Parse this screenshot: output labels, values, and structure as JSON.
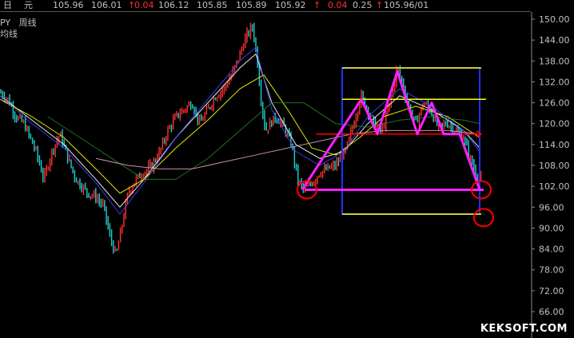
{
  "topbar": {
    "period": "日",
    "currency": "元",
    "fields": [
      "105.96",
      "106.01",
      "0.04",
      "106.12",
      "105.85",
      "105.89",
      "105.92",
      "0.04",
      "0.25",
      "105.96/01"
    ]
  },
  "legend": {
    "symbol_fragment": "PY",
    "period_label": "周线",
    "line2_fragment": "均线"
  },
  "watermark": "KEKSOFT.COM",
  "colors": {
    "up": "#ff3030",
    "down": "#20d0d0",
    "ma_white": "#ffffff",
    "ma_yellow": "#ffff00",
    "ma_blue": "#4040ff",
    "ma_green": "#208020",
    "ma_pink": "#e0a0c0",
    "pattern": "#ff20ff",
    "circle": "#ff0000",
    "channel_lines": "#ffff00",
    "box": "#2030ff",
    "neckline": "#ff0000"
  },
  "chart_data": {
    "type": "candlestick",
    "ylim": [
      63,
      152
    ],
    "yticks": [
      "150.00",
      "144.00",
      "138.00",
      "132.00",
      "126.00",
      "120.00",
      "114.00",
      "108.00",
      "102.00",
      "96.00",
      "90.00",
      "84.00",
      "78.00",
      "72.00",
      "66.00"
    ],
    "price_path": [
      [
        0,
        129
      ],
      [
        10,
        127
      ],
      [
        20,
        122
      ],
      [
        30,
        120
      ],
      [
        45,
        112
      ],
      [
        55,
        104
      ],
      [
        65,
        112
      ],
      [
        75,
        117
      ],
      [
        85,
        110
      ],
      [
        95,
        104
      ],
      [
        110,
        100
      ],
      [
        120,
        99
      ],
      [
        130,
        96
      ],
      [
        137,
        88
      ],
      [
        145,
        82
      ],
      [
        152,
        90
      ],
      [
        160,
        100
      ],
      [
        170,
        104
      ],
      [
        180,
        106
      ],
      [
        190,
        108
      ],
      [
        200,
        112
      ],
      [
        210,
        118
      ],
      [
        220,
        122
      ],
      [
        230,
        124
      ],
      [
        240,
        126
      ],
      [
        250,
        120
      ],
      [
        260,
        124
      ],
      [
        270,
        128
      ],
      [
        280,
        130
      ],
      [
        290,
        134
      ],
      [
        300,
        140
      ],
      [
        308,
        145
      ],
      [
        316,
        148
      ],
      [
        322,
        138
      ],
      [
        326,
        128
      ],
      [
        332,
        118
      ],
      [
        338,
        120
      ],
      [
        345,
        122
      ],
      [
        355,
        119
      ],
      [
        365,
        114
      ],
      [
        372,
        104
      ],
      [
        380,
        101
      ],
      [
        390,
        103
      ],
      [
        400,
        106
      ],
      [
        410,
        107
      ],
      [
        420,
        108
      ],
      [
        432,
        112
      ],
      [
        440,
        118
      ],
      [
        452,
        128
      ],
      [
        460,
        124
      ],
      [
        468,
        120
      ],
      [
        478,
        118
      ],
      [
        488,
        126
      ],
      [
        497,
        136
      ],
      [
        505,
        130
      ],
      [
        512,
        124
      ],
      [
        520,
        120
      ],
      [
        530,
        126
      ],
      [
        538,
        124
      ],
      [
        548,
        119
      ],
      [
        560,
        120
      ],
      [
        570,
        118
      ],
      [
        580,
        116
      ],
      [
        588,
        110
      ],
      [
        595,
        106
      ],
      [
        602,
        104
      ]
    ],
    "moving_averages": [
      {
        "name": "white",
        "points": [
          [
            0,
            128
          ],
          [
            40,
            121
          ],
          [
            80,
            114
          ],
          [
            120,
            104
          ],
          [
            150,
            96
          ],
          [
            180,
            104
          ],
          [
            220,
            116
          ],
          [
            260,
            126
          ],
          [
            300,
            136
          ],
          [
            320,
            140
          ],
          [
            340,
            126
          ],
          [
            370,
            114
          ],
          [
            400,
            110
          ],
          [
            430,
            112
          ],
          [
            460,
            120
          ],
          [
            500,
            128
          ],
          [
            540,
            124
          ],
          [
            580,
            118
          ],
          [
            600,
            113
          ]
        ]
      },
      {
        "name": "yellow",
        "points": [
          [
            0,
            127
          ],
          [
            40,
            122
          ],
          [
            80,
            116
          ],
          [
            120,
            107
          ],
          [
            150,
            100
          ],
          [
            180,
            104
          ],
          [
            220,
            113
          ],
          [
            260,
            121
          ],
          [
            300,
            130
          ],
          [
            330,
            134
          ],
          [
            360,
            124
          ],
          [
            390,
            113
          ],
          [
            420,
            111
          ],
          [
            450,
            116
          ],
          [
            480,
            122
          ],
          [
            520,
            125
          ],
          [
            560,
            122
          ],
          [
            600,
            116
          ]
        ]
      },
      {
        "name": "blue",
        "points": [
          [
            0,
            128
          ],
          [
            40,
            120
          ],
          [
            80,
            113
          ],
          [
            120,
            103
          ],
          [
            150,
            94
          ],
          [
            180,
            103
          ],
          [
            220,
            116
          ],
          [
            260,
            127
          ],
          [
            300,
            138
          ],
          [
            320,
            142
          ],
          [
            340,
            124
          ],
          [
            370,
            112
          ],
          [
            400,
            108
          ],
          [
            430,
            112
          ],
          [
            460,
            122
          ],
          [
            500,
            130
          ],
          [
            540,
            125
          ],
          [
            580,
            118
          ],
          [
            600,
            112
          ]
        ]
      },
      {
        "name": "green",
        "points": [
          [
            60,
            122
          ],
          [
            100,
            116
          ],
          [
            140,
            110
          ],
          [
            180,
            104
          ],
          [
            220,
            104
          ],
          [
            260,
            110
          ],
          [
            300,
            118
          ],
          [
            340,
            126
          ],
          [
            380,
            126
          ],
          [
            420,
            120
          ],
          [
            460,
            119
          ],
          [
            500,
            121
          ],
          [
            540,
            122
          ],
          [
            580,
            121
          ],
          [
            600,
            120
          ]
        ]
      },
      {
        "name": "pink",
        "points": [
          [
            120,
            110
          ],
          [
            160,
            108
          ],
          [
            200,
            107
          ],
          [
            240,
            107
          ],
          [
            280,
            109
          ],
          [
            320,
            111
          ],
          [
            360,
            113
          ],
          [
            400,
            115
          ],
          [
            440,
            117
          ],
          [
            480,
            118
          ],
          [
            520,
            118
          ],
          [
            560,
            118
          ],
          [
            600,
            117
          ]
        ]
      }
    ],
    "pattern_path": [
      [
        378,
        101
      ],
      [
        452,
        127
      ],
      [
        472,
        117
      ],
      [
        497,
        135
      ],
      [
        522,
        117
      ],
      [
        540,
        126
      ],
      [
        555,
        117
      ],
      [
        575,
        117
      ],
      [
        600,
        101
      ]
    ],
    "neckline": {
      "x": [
        395,
        602
      ],
      "y": 117
    },
    "support_line": {
      "x": [
        382,
        605
      ],
      "y": 101
    },
    "channel_lines": [
      {
        "x": [
          428,
          602
        ],
        "y": 136
      },
      {
        "x": [
          428,
          608
        ],
        "y": 127
      },
      {
        "x": [
          428,
          602
        ],
        "y": 94
      }
    ],
    "box": {
      "x": [
        428,
        600
      ],
      "y": [
        94,
        136
      ]
    },
    "circles": [
      [
        384,
        101
      ],
      [
        602,
        101
      ],
      [
        605,
        93
      ]
    ]
  }
}
